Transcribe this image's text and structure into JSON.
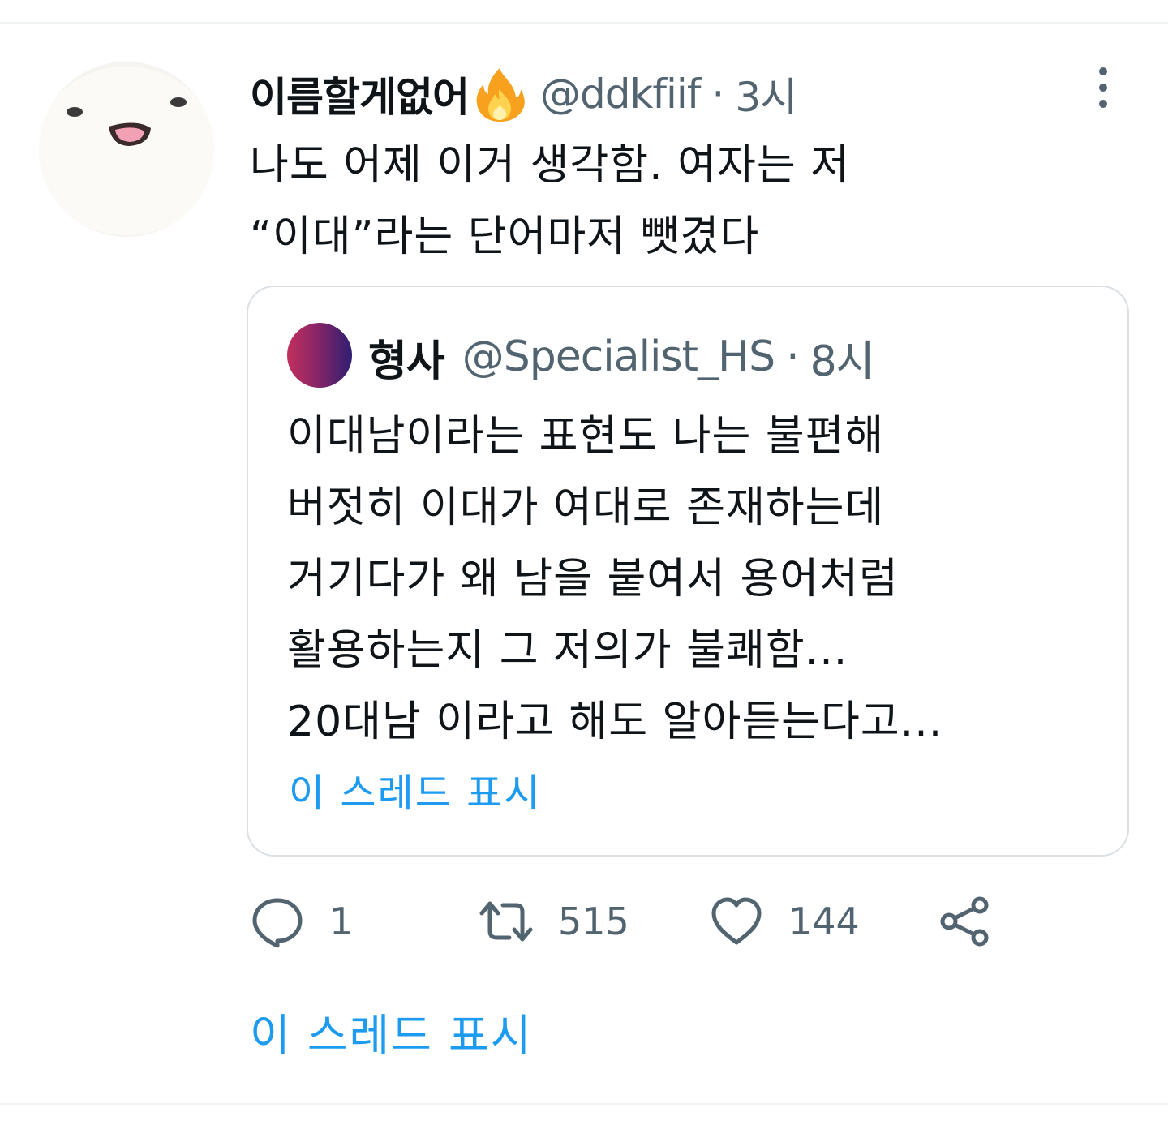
{
  "tweet": {
    "display_name": "이름할게없어",
    "badge_icon": "fire-emoji-icon",
    "handle": "@ddkfiif",
    "separator": "·",
    "time": "3시",
    "body_lines": [
      "나도 어제 이거 생각함. 여자는 저",
      "“이대”라는 단어마저 뺏겼다"
    ]
  },
  "quote": {
    "avatar_colors": [
      "#c2305c",
      "#2e1f72"
    ],
    "display_name": "형사",
    "handle": "@Specialist_HS",
    "separator": "·",
    "time": "8시",
    "body_lines": [
      "이대남이라는 표현도 나는 불편해",
      "버젓히 이대가 여대로 존재하는데",
      "거기다가 왜 남을 붙여서 용어처럼",
      "활용하는지 그 저의가 불쾌함...",
      "20대남 이라고 해도 알아듣는다고..."
    ],
    "show_thread": "이 스레드 표시"
  },
  "actions": {
    "reply_count": "1",
    "retweet_count": "515",
    "like_count": "144"
  },
  "show_thread": "이 스레드 표시",
  "colors": {
    "link": "#1d9bf0",
    "secondary_text": "#536471",
    "primary_text": "#0f1419",
    "border": "#dbe0e4"
  }
}
